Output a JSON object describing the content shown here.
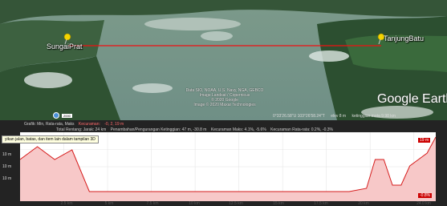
{
  "map": {
    "places": [
      {
        "name": "SungaiPrat"
      },
      {
        "name": "TanjungBatu"
      }
    ],
    "attribution": [
      "Data SIO, NOAA, U.S. Navy, NGA, GEBCO",
      "Image Landsat / Copernicus",
      "© 2020 Google",
      "Image © 2020 Maxar Technologies"
    ],
    "logo": "Google Earth",
    "scale_label": "2000",
    "status": {
      "coords": "0°33'26.58\"U 103°26'58.24\"T",
      "elev": "elev 8 m",
      "eye_alt": "ketinggian mata 9.98 km"
    }
  },
  "profile": {
    "stats_row1": {
      "prefix": "Grafik: Min, Rata-rata, Maks",
      "slope_label": "Kecuraman:",
      "slope_value": "-0, 2, 19 m"
    },
    "stats_row2": {
      "range": "Total Rentang: Jarak: 24 km",
      "gain_loss": "Penambahan/Pengurangan Ketinggian: 47 m, -30.8 m",
      "max_slope": "Kecuraman Maks: 4.1%, -5.6%",
      "avg_slope": "Kecuraman Rata-rata: 0.2%, -0.3%"
    },
    "tooltip": "yikan jalan, batas, dan item lain dalam tampilan 3D",
    "y_labels": [
      "10 m",
      "10 m",
      "10 m"
    ],
    "x_labels": [
      "2.5 km",
      "5 km",
      "7.5 km",
      "10 km",
      "12.5 km",
      "15 km",
      "17.5 km",
      "20 km",
      "24.0 km"
    ],
    "max_badge": "19 m",
    "grade_badge": "-0.8%"
  },
  "chart_data": {
    "type": "area",
    "xlabel": "",
    "ylabel": "",
    "x": [
      0,
      1,
      2,
      3,
      4,
      5,
      6,
      7,
      8,
      9,
      10,
      11,
      12,
      13,
      14,
      15,
      16,
      17,
      18,
      19,
      20,
      20.5,
      21,
      21.5,
      22,
      22.5,
      23,
      23.5,
      24
    ],
    "series": [
      {
        "values": [
          12,
          16,
          12,
          15,
          2,
          2,
          2,
          2,
          2,
          2,
          2,
          2,
          2,
          2,
          2,
          2,
          2,
          2,
          2,
          2,
          3,
          12,
          12,
          4,
          4,
          10,
          12,
          14,
          19
        ]
      }
    ],
    "ylim": [
      0,
      19
    ],
    "xlim": [
      0,
      24
    ],
    "colors": {
      "fill": "#f7c8c8",
      "line": "#d61c1c"
    }
  }
}
